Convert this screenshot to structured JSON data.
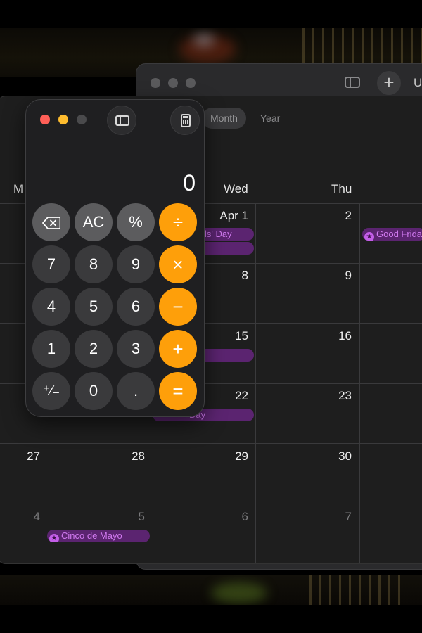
{
  "browser": {
    "plus_label": "+",
    "cut_text": "U"
  },
  "calendar": {
    "view_tabs": [
      {
        "label": "Month",
        "active": true
      },
      {
        "label": "Year",
        "active": false
      }
    ],
    "weekday_headers": [
      "M",
      "Wed",
      "Thu"
    ],
    "rows": [
      {
        "cells": [
          {
            "n": "",
            "dim": false
          },
          {
            "n": "",
            "dim": false
          },
          {
            "n": "Apr 1",
            "dim": false
          },
          {
            "n": "2",
            "dim": false
          },
          {
            "n": "",
            "dim": false
          }
        ]
      },
      {
        "cells": [
          {
            "n": "",
            "dim": false
          },
          {
            "n": "",
            "dim": false
          },
          {
            "n": "8",
            "dim": false
          },
          {
            "n": "9",
            "dim": false
          },
          {
            "n": "",
            "dim": false
          }
        ]
      },
      {
        "cells": [
          {
            "n": "",
            "dim": false
          },
          {
            "n": "",
            "dim": false
          },
          {
            "n": "15",
            "dim": false
          },
          {
            "n": "16",
            "dim": false
          },
          {
            "n": "",
            "dim": false
          }
        ]
      },
      {
        "cells": [
          {
            "n": "",
            "dim": false
          },
          {
            "n": "",
            "dim": false
          },
          {
            "n": "22",
            "dim": false
          },
          {
            "n": "23",
            "dim": false
          },
          {
            "n": "",
            "dim": false
          }
        ]
      },
      {
        "cells": [
          {
            "n": "27",
            "dim": false
          },
          {
            "n": "28",
            "dim": false
          },
          {
            "n": "29",
            "dim": false
          },
          {
            "n": "30",
            "dim": false
          },
          {
            "n": "",
            "dim": false
          }
        ]
      },
      {
        "cells": [
          {
            "n": "4",
            "dim": true
          },
          {
            "n": "5",
            "dim": false
          },
          {
            "n": "6",
            "dim": true
          },
          {
            "n": "7",
            "dim": true
          },
          {
            "n": "",
            "dim": false
          }
        ]
      }
    ],
    "events": {
      "fools_day": "ls' Day",
      "good_friday": "Good Frida",
      "earth_day": "Day",
      "cinco_de_mayo": "Cinco de Mayo"
    },
    "event_color": "#5b2470",
    "event_text_color": "#d17af0"
  },
  "calculator": {
    "display": "0",
    "keys": {
      "backspace": "⌫",
      "ac": "AC",
      "percent": "%",
      "divide": "÷",
      "seven": "7",
      "eight": "8",
      "nine": "9",
      "multiply": "×",
      "four": "4",
      "five": "5",
      "six": "6",
      "minus": "−",
      "one": "1",
      "two": "2",
      "three": "3",
      "plus": "+",
      "sign": "⁺∕₋",
      "zero": "0",
      "decimal": ".",
      "equals": "="
    },
    "colors": {
      "operator": "#fe9f0a",
      "function": "#5c5c5e",
      "number": "#3a3a3c"
    }
  }
}
